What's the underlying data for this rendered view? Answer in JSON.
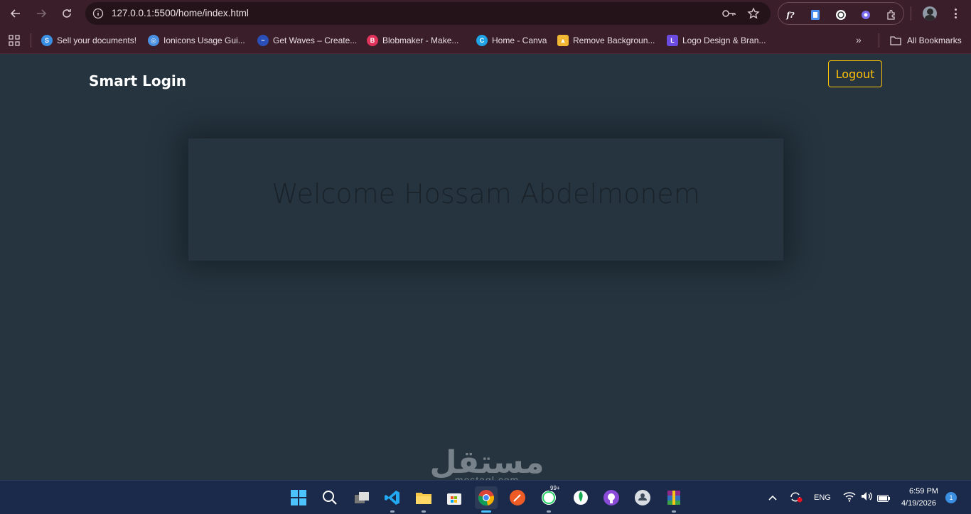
{
  "browser": {
    "url": "127.0.0.1:5500/home/index.html",
    "bookmarks": [
      {
        "label": "Sell your documents!",
        "icon": "s-circle-icon",
        "color": "#3b8fe3",
        "glyph": "S"
      },
      {
        "label": "Ionicons Usage Gui...",
        "icon": "ionicons-icon",
        "color": "#4a90e2",
        "glyph": "◎"
      },
      {
        "label": "Get Waves – Create...",
        "icon": "waves-icon",
        "color": "#2a4fb8",
        "glyph": "~"
      },
      {
        "label": "Blobmaker - Make...",
        "icon": "blobmaker-icon",
        "color": "#e0335b",
        "glyph": "B"
      },
      {
        "label": "Home - Canva",
        "icon": "canva-icon",
        "color": "#1fa3e6",
        "glyph": "C"
      },
      {
        "label": "Remove Backgroun...",
        "icon": "remove-bg-icon",
        "color": "#f2b833",
        "glyph": "▲"
      },
      {
        "label": "Logo Design & Bran...",
        "icon": "logo-design-icon",
        "color": "#6b4be0",
        "glyph": "L"
      }
    ],
    "all_bookmarks_label": "All Bookmarks"
  },
  "page": {
    "brand": "Smart Login",
    "logout_label": "Logout",
    "welcome_text": "Welcome Hossam Abdelmonem"
  },
  "watermark": {
    "arabic": "مستقل",
    "latin": "mostaql.com"
  },
  "taskbar": {
    "language": "ENG",
    "time": "6:59 PM",
    "date": "4/19/2026",
    "notification_count": "1",
    "whatsapp_badge": "99+"
  },
  "colors": {
    "chrome_bg": "#3a1f2b",
    "page_bg": "#25343f",
    "accent_yellow": "#ffc107",
    "taskbar_bg": "#1b2a4a"
  }
}
